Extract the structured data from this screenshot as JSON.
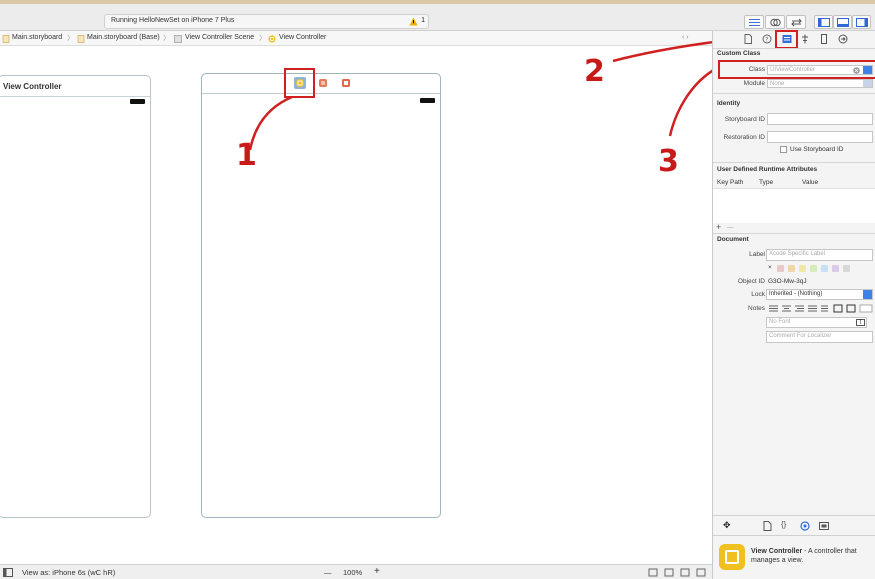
{
  "toolbar": {
    "activity_text": "Running HelloNewSet on iPhone 7 Plus",
    "warning_count": "1"
  },
  "jumpbar": {
    "crumbs": [
      "Main.storyboard",
      "Main.storyboard (Base)",
      "View Controller Scene",
      "View Controller"
    ]
  },
  "canvas": {
    "left_scene_title": "View Controller",
    "annotations": [
      "1",
      "2",
      "3"
    ]
  },
  "bottombar": {
    "view_as": "View as: iPhone 6s (wC hR)",
    "zoom_minus": "—",
    "zoom": "100%",
    "zoom_plus": "+"
  },
  "inspector": {
    "custom_class": {
      "title": "Custom Class",
      "class_label": "Class",
      "class_placeholder": "UIViewController",
      "module_label": "Module",
      "module_placeholder": "None"
    },
    "identity": {
      "title": "Identity",
      "storyboard_id_label": "Storyboard ID",
      "restoration_id_label": "Restoration ID",
      "use_storyboard_id": "Use Storyboard ID"
    },
    "runtime_attrs": {
      "title": "User Defined Runtime Attributes",
      "columns": [
        "Key Path",
        "Type",
        "Value"
      ],
      "add": "+",
      "remove": "—"
    },
    "document": {
      "title": "Document",
      "label_label": "Label",
      "label_placeholder": "Xcode Specific Label",
      "clear_mark": "×",
      "swatches": [
        "#e8c9c9",
        "#f2d6a8",
        "#efe8a8",
        "#d6ecb8",
        "#c8e0f2",
        "#dccbe8",
        "#d8d8d8"
      ],
      "object_id_label": "Object ID",
      "object_id": "G3O-Mw-3qJ",
      "lock_label": "Lock",
      "lock_value": "Inherited - (Nothing)",
      "notes_label": "Notes",
      "font_placeholder": "No Font",
      "comment_placeholder": "Comment For Localizer"
    },
    "library": {
      "name": "View Controller",
      "desc": " - A controller that manages a view."
    }
  },
  "colors": {
    "annotation_red": "#d02020",
    "accent_blue": "#3e82e8",
    "vc_yellow": "#f0c020"
  }
}
